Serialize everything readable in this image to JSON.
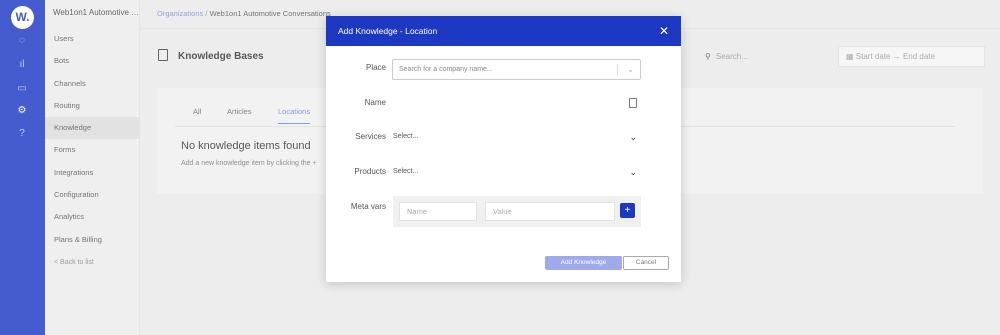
{
  "rail": {
    "logo": "W.",
    "icons": [
      "chat-icon",
      "analytics-icon",
      "calendar-icon",
      "settings-icon",
      "help-icon"
    ]
  },
  "sidebar": {
    "org": "Web1on1 Automotive C...",
    "items": [
      {
        "label": "Users"
      },
      {
        "label": "Bots"
      },
      {
        "label": "Channels"
      },
      {
        "label": "Routing"
      },
      {
        "label": "Knowledge"
      },
      {
        "label": "Forms"
      },
      {
        "label": "Integrations"
      },
      {
        "label": "Configuration"
      },
      {
        "label": "Analytics"
      },
      {
        "label": "Plans & Billing"
      }
    ],
    "back": "< Back to list"
  },
  "breadcrumb": {
    "root": "Organizations",
    "sep": "/",
    "current": "Web1on1 Automotive Conversations"
  },
  "page": {
    "title": "Knowledge Bases",
    "search_placeholder": "Search...",
    "start_date": "Start date",
    "date_sep": "→",
    "end_date": "End date",
    "tabs": [
      "All",
      "Articles",
      "Locations"
    ],
    "empty_title": "No knowledge items found",
    "empty_sub": "Add a new knowledge item by clicking the +"
  },
  "modal": {
    "title": "Add Knowledge - Location",
    "labels": {
      "place": "Place",
      "name": "Name",
      "services": "Services",
      "products": "Products",
      "meta": "Meta vars"
    },
    "place_placeholder": "Search for a company name...",
    "services_value": "Select...",
    "products_value": "Select...",
    "meta_name_placeholder": "Name",
    "meta_value_placeholder": "Value",
    "plus_label": "+",
    "add_label": "Add Knowledge",
    "cancel_label": "Cancel"
  },
  "colors": {
    "brand": "#1d39c4",
    "add_button_disabled": "#9eaaea"
  }
}
